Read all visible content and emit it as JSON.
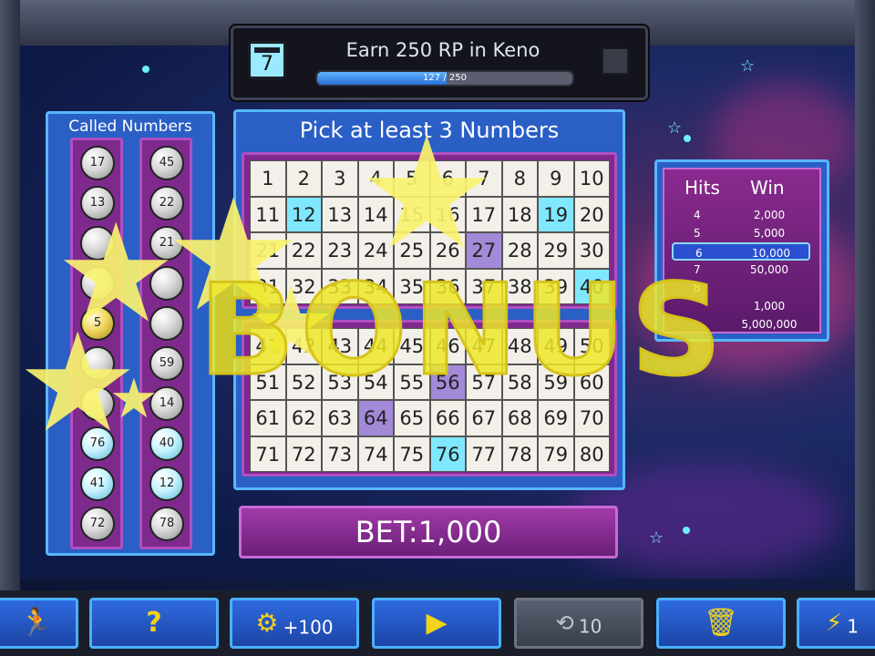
{
  "mission": {
    "calendar_day": "7",
    "title": "Earn 250 RP in Keno",
    "progress_text": "127 / 250",
    "progress_fraction": 0.508
  },
  "called_numbers": {
    "title": "Called Numbers",
    "left_column": [
      "17",
      "13",
      "",
      "",
      "5",
      "",
      "",
      "76",
      "41",
      "72"
    ],
    "right_column": [
      "45",
      "22",
      "21",
      "",
      "",
      "59",
      "14",
      "40",
      "12",
      "78"
    ]
  },
  "board": {
    "title": "Pick at least 3 Numbers",
    "numbers": [
      "1",
      "2",
      "3",
      "4",
      "5",
      "6",
      "7",
      "8",
      "9",
      "10",
      "11",
      "12",
      "13",
      "14",
      "15",
      "16",
      "17",
      "18",
      "19",
      "20",
      "21",
      "22",
      "23",
      "24",
      "25",
      "26",
      "27",
      "28",
      "29",
      "30",
      "31",
      "32",
      "33",
      "34",
      "35",
      "36",
      "37",
      "38",
      "39",
      "40",
      "41",
      "42",
      "43",
      "44",
      "45",
      "46",
      "47",
      "48",
      "49",
      "50",
      "51",
      "52",
      "53",
      "54",
      "55",
      "56",
      "57",
      "58",
      "59",
      "60",
      "61",
      "62",
      "63",
      "64",
      "65",
      "66",
      "67",
      "68",
      "69",
      "70",
      "71",
      "72",
      "73",
      "74",
      "75",
      "76",
      "77",
      "78",
      "79",
      "80"
    ],
    "hits": [
      "12",
      "19",
      "40",
      "76"
    ],
    "picked_misses": [
      "27",
      "56",
      "64"
    ]
  },
  "bet": {
    "label": "BET:",
    "value": "1,000"
  },
  "paytable": {
    "hits_header": "Hits",
    "win_header": "Win",
    "rows": [
      {
        "hits": "4",
        "win": "2,000"
      },
      {
        "hits": "5",
        "win": "5,000"
      },
      {
        "hits": "6",
        "win": "10,000",
        "selected": true
      },
      {
        "hits": "7",
        "win": "50,000"
      },
      {
        "hits": "8",
        "win": ""
      },
      {
        "hits": "",
        "win": "1,000"
      },
      {
        "hits": "",
        "win": "5,000,000"
      }
    ]
  },
  "overlay": {
    "text": "BONUS"
  },
  "toolbar": {
    "exit_icon": "exit-icon",
    "help_icon": "question-icon",
    "coin_label": "+100",
    "play_icon": "play-icon",
    "autoplay_label": "10",
    "clear_icon": "trash-icon",
    "turbo_label": "1"
  },
  "colors": {
    "accent_blue": "#2a5fc6",
    "panel_purple": "#7e2a8c",
    "hit_cyan": "#7fe8ff",
    "bonus_yellow": "#ece828"
  }
}
